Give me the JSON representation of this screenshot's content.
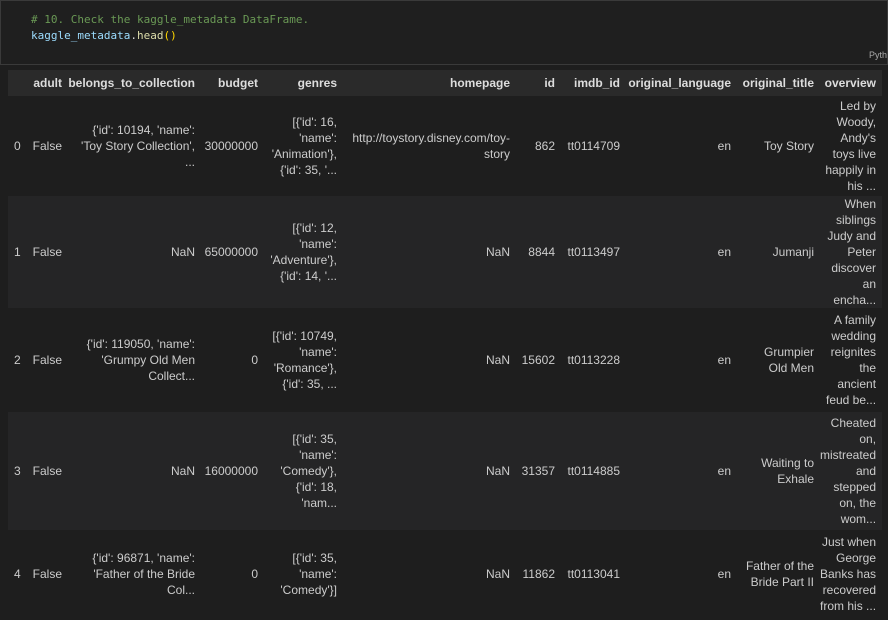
{
  "cell": {
    "comment": "# 10. Check the kaggle_metadata DataFrame.",
    "code_var": "kaggle_metadata",
    "code_dot": ".",
    "code_fn": "head",
    "code_parens": "()",
    "language": "Pyth"
  },
  "table": {
    "columns": [
      "",
      "adult",
      "belongs_to_collection",
      "budget",
      "genres",
      "homepage",
      "id",
      "imdb_id",
      "original_language",
      "original_title",
      "overview"
    ],
    "rows": [
      {
        "height": 100,
        "cells": [
          [
            "0"
          ],
          [
            "False"
          ],
          [
            "{'id': 10194, 'name':",
            "'Toy Story Collection',",
            "..."
          ],
          [
            "30000000"
          ],
          [
            "[{'id': 16,",
            "'name':",
            "'Animation'},",
            "{'id': 35, '..."
          ],
          [
            "http://toystory.disney.com/toy-",
            "story"
          ],
          [
            "862"
          ],
          [
            "tt0114709"
          ],
          [
            "en"
          ],
          [
            "Toy Story"
          ],
          [
            "Led by",
            "Woody,",
            "Andy's",
            "toys live",
            "happily in",
            "his ..."
          ]
        ]
      },
      {
        "height": 102,
        "cells": [
          [
            "1"
          ],
          [
            "False"
          ],
          [
            "NaN"
          ],
          [
            "65000000"
          ],
          [
            "[{'id': 12,",
            "'name':",
            "'Adventure'},",
            "{'id': 14, '..."
          ],
          [
            "NaN"
          ],
          [
            "8844"
          ],
          [
            "tt0113497"
          ],
          [
            "en"
          ],
          [
            "Jumanji"
          ],
          [
            "When",
            "siblings",
            "Judy and",
            "Peter",
            "discover",
            "an encha..."
          ]
        ]
      },
      {
        "height": 104,
        "cells": [
          [
            "2"
          ],
          [
            "False"
          ],
          [
            "{'id': 119050, 'name':",
            "'Grumpy Old Men",
            "Collect..."
          ],
          [
            "0"
          ],
          [
            "[{'id': 10749,",
            "'name':",
            "'Romance'},",
            "{'id': 35, ..."
          ],
          [
            "NaN"
          ],
          [
            "15602"
          ],
          [
            "tt0113228"
          ],
          [
            "en"
          ],
          [
            "Grumpier",
            "Old Men"
          ],
          [
            "A family",
            "wedding",
            "reignites",
            "the",
            "ancient",
            "feud be..."
          ]
        ]
      },
      {
        "height": 118,
        "cells": [
          [
            "3"
          ],
          [
            "False"
          ],
          [
            "NaN"
          ],
          [
            "16000000"
          ],
          [
            "[{'id': 35,",
            "'name':",
            "'Comedy'},",
            "{'id': 18,",
            "'nam..."
          ],
          [
            "NaN"
          ],
          [
            "31357"
          ],
          [
            "tt0114885"
          ],
          [
            "en"
          ],
          [
            "Waiting to",
            "Exhale"
          ],
          [
            "Cheated",
            "on,",
            "mistreated",
            "and",
            "stepped",
            "on, the",
            "wom..."
          ]
        ]
      },
      {
        "height": 88,
        "cells": [
          [
            "4"
          ],
          [
            "False"
          ],
          [
            "{'id': 96871, 'name':",
            "'Father of the Bride",
            "Col..."
          ],
          [
            "0"
          ],
          [
            "[{'id': 35,",
            "'name':",
            "'Comedy'}]"
          ],
          [
            "NaN"
          ],
          [
            "11862"
          ],
          [
            "tt0113041"
          ],
          [
            "en"
          ],
          [
            "Father of the",
            "Bride Part II"
          ],
          [
            "Just when",
            "George",
            "Banks has",
            "recovered",
            "from his ..."
          ]
        ]
      }
    ]
  }
}
